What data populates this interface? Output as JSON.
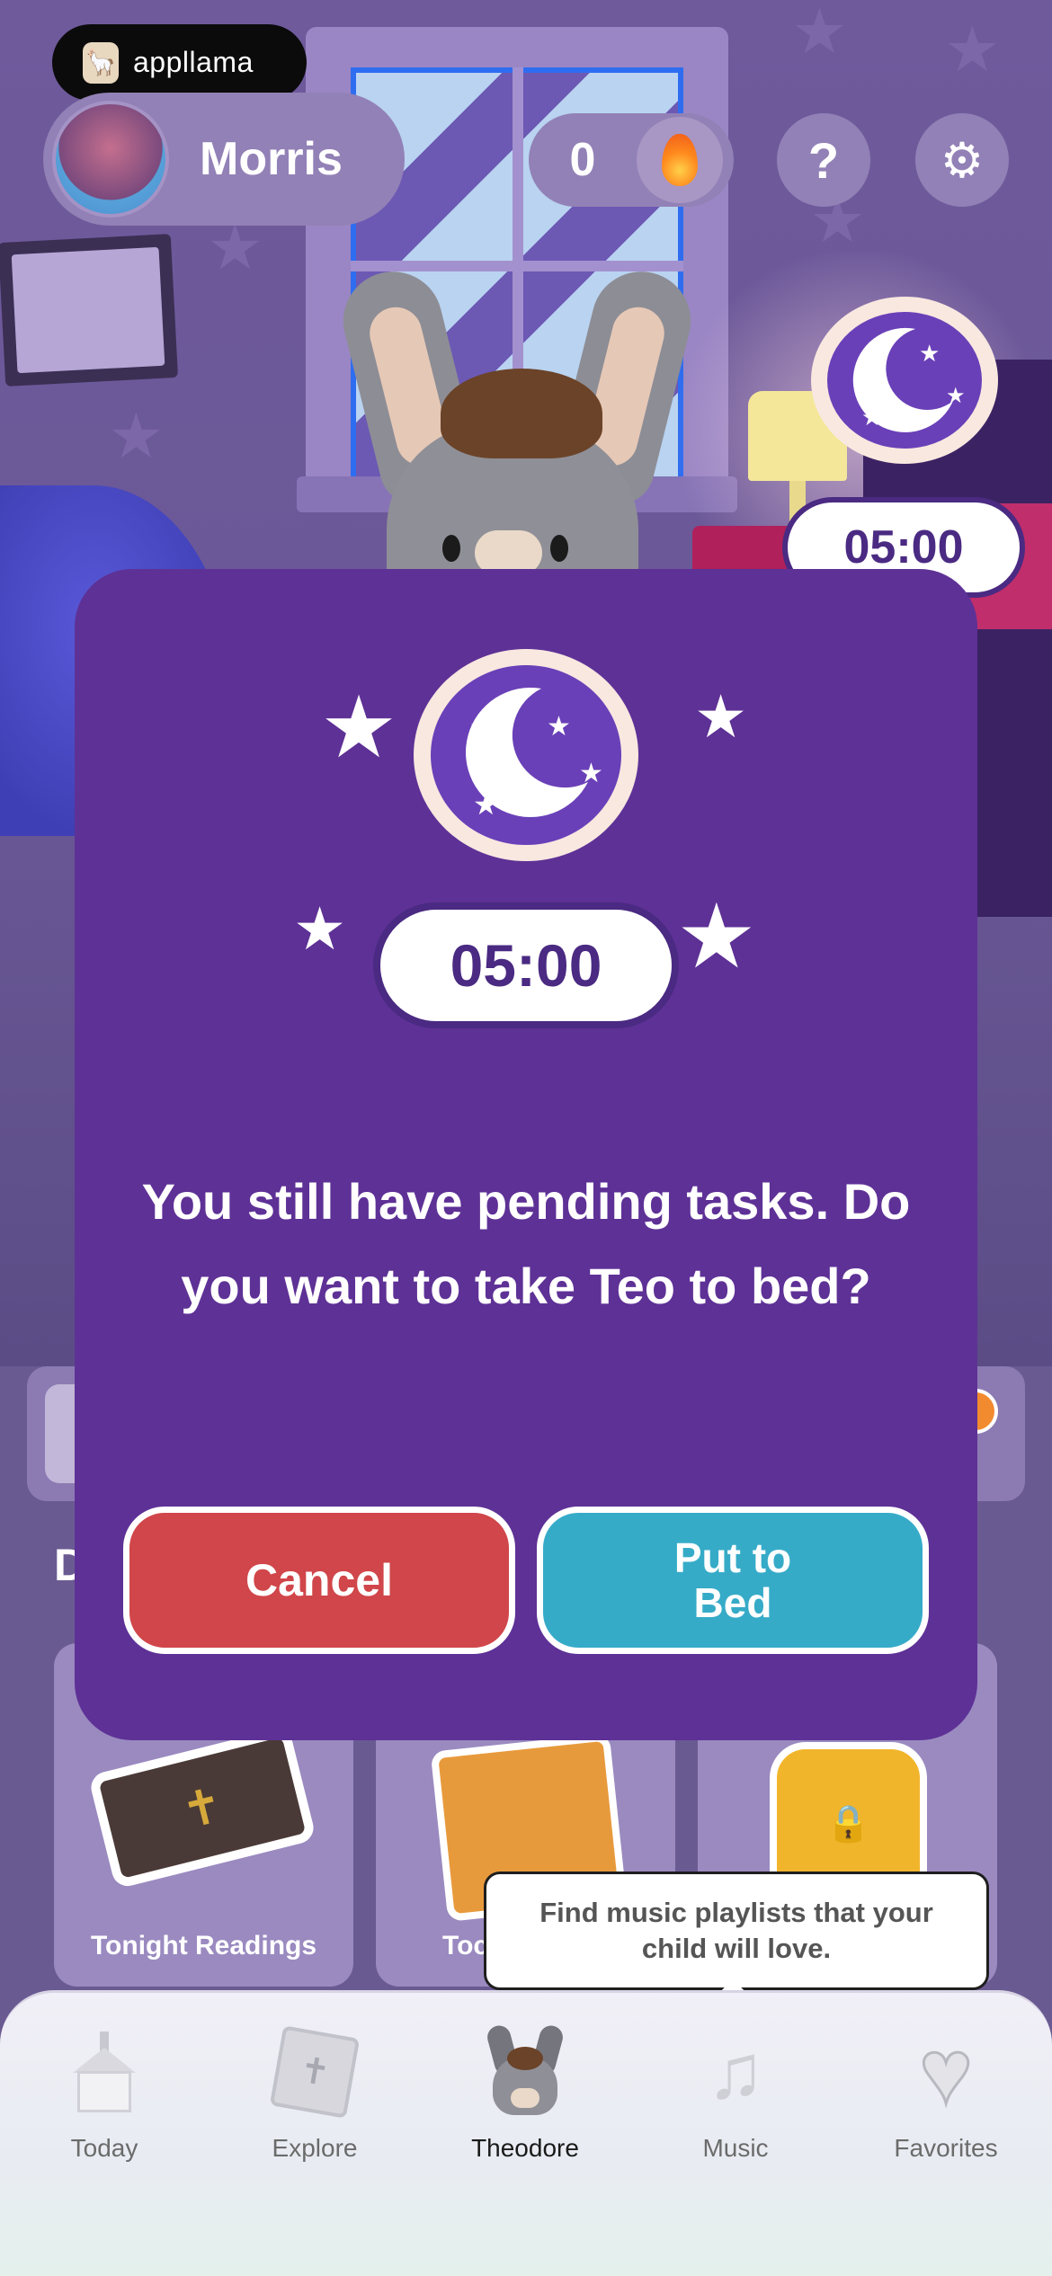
{
  "brand": {
    "name": "appllama",
    "logo_icon": "llama-icon"
  },
  "profile": {
    "name": "Morris",
    "avatar_icon": "donkey-avatar"
  },
  "streak": {
    "count": "0",
    "icon": "flame-icon"
  },
  "header_buttons": {
    "help_label": "?",
    "settings_icon": "gear-icon"
  },
  "sleep_timer": {
    "time": "05:00",
    "icon": "moon-icon"
  },
  "background": {
    "section_title_fragment": "D",
    "cards": [
      {
        "label": "Tonight Readings"
      },
      {
        "label": "Toc"
      },
      {
        "label": ""
      }
    ]
  },
  "modal": {
    "timer": "05:00",
    "message": "You still have pending tasks. Do you want to take Teo to bed?",
    "cancel_label": "Cancel",
    "confirm_label": "Put to Bed"
  },
  "tooltip": {
    "text": "Find music playlists that your child will love."
  },
  "tabbar": {
    "active": "Theodore",
    "items": [
      {
        "label": "Today",
        "icon": "church-icon"
      },
      {
        "label": "Explore",
        "icon": "bible-icon"
      },
      {
        "label": "Theodore",
        "icon": "donkey-icon"
      },
      {
        "label": "Music",
        "icon": "music-note-icon"
      },
      {
        "label": "Favorites",
        "icon": "heart-icon"
      }
    ]
  },
  "colors": {
    "modal_bg": "#5e3196",
    "cancel": "#d0464a",
    "confirm": "#36abc8",
    "accent_purple": "#4a2a82"
  }
}
